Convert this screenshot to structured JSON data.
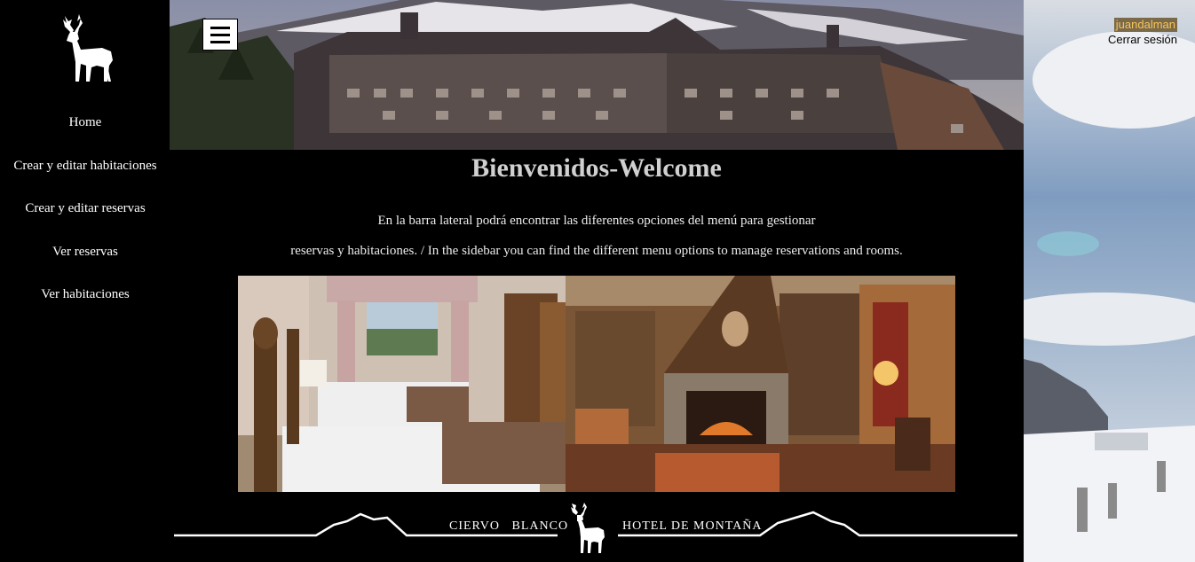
{
  "sidebar": {
    "logo": "deer-logo",
    "items": [
      {
        "label": "Home"
      },
      {
        "label": "Crear y editar habitaciones"
      },
      {
        "label": "Crear y editar reservas"
      },
      {
        "label": "Ver reservas"
      },
      {
        "label": "Ver habitaciones"
      }
    ]
  },
  "header": {
    "menu_icon": "hamburger-icon",
    "banner_image": "hotel-building-mountain-photo"
  },
  "user": {
    "username": "juandalman",
    "logout_label": "Cerrar sesión"
  },
  "main": {
    "title": "Bienvenidos-Welcome",
    "intro_line1": "En la barra lateral podrá encontrar las diferentes opciones del menú para gestionar",
    "intro_line2": "reservas y habitaciones. / In the sidebar you can find the different menu options to manage reservations and rooms.",
    "photos": [
      "bedroom-photo",
      "living-room-fireplace-photo"
    ]
  },
  "footer": {
    "brand_left": "CIERVO   BLANCO",
    "brand_right": "HOTEL DE MONTAÑA"
  },
  "colors": {
    "background": "#000000",
    "text": "#ffffff",
    "title": "#d0d0d0",
    "username_bg": "#7a6a4a",
    "username_text": "#f6c45a"
  }
}
